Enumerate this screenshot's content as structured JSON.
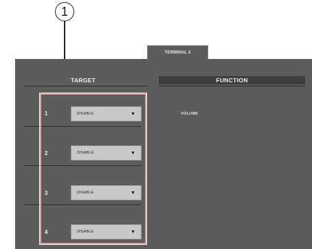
{
  "callout": {
    "number": "1"
  },
  "tab": {
    "label": "TERMINAL 3"
  },
  "headers": {
    "target": "TARGET",
    "function": "FUNCTION"
  },
  "rows": [
    {
      "number": "1",
      "target_value": "DISABLE",
      "function_value": "VOLUME"
    },
    {
      "number": "2",
      "target_value": "DISABLE"
    },
    {
      "number": "3",
      "target_value": "DISABLE"
    },
    {
      "number": "4",
      "target_value": "DISABLE"
    }
  ],
  "icons": {
    "dropdown": "caret-down-icon"
  },
  "colors": {
    "panel": "#5c5c5c",
    "function_header": "#3e3e3e",
    "select": "#c8c8c8",
    "highlight": "#e89aa4"
  }
}
